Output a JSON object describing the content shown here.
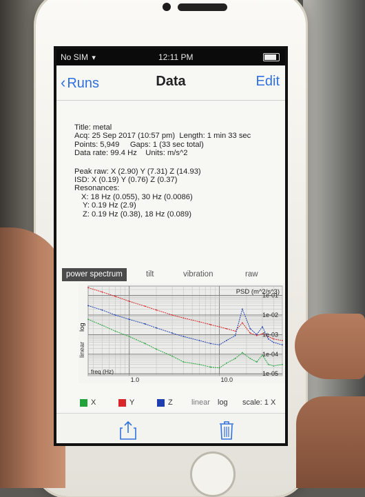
{
  "status": {
    "carrier": "No SIM",
    "time": "12:11 PM"
  },
  "nav": {
    "back_label": "Runs",
    "title": "Data",
    "edit_label": "Edit"
  },
  "info": {
    "title": "Title: metal",
    "acq": "Acq: 25 Sep 2017 (10:57 pm)",
    "length": "Length: 1 min 33 sec",
    "points": "Points: 5,949",
    "gaps": "Gaps: 1 (33 sec total)",
    "rate": "Data rate: 99.4 Hz",
    "units": "Units: m/s^2",
    "peak_raw": "Peak raw: X (2.90) Y (7.31) Z (14.93)",
    "isd": "ISD: X (0.19) Y (0.76) Z (0.37)",
    "resonances_label": "Resonances:",
    "res_x": "X:  18 Hz (0.055), 30 Hz (0.0086)",
    "res_y": "Y:  0.19 Hz (2.9)",
    "res_z": "Z:  0.19 Hz (0.38), 18 Hz (0.089)"
  },
  "tabs": [
    "power spectrum",
    "tilt",
    "vibration",
    "raw"
  ],
  "chart_labels": {
    "y_unit": "PSD (m^2/s^3)",
    "y_ticks": [
      "1e-01",
      "1e-02",
      "1e-03",
      "1e-04",
      "1e-05"
    ],
    "x_label": "freq (Hz)",
    "x_ticks": [
      "1.0",
      "10.0"
    ],
    "axis_linear": "linear",
    "axis_log": "log"
  },
  "chart_data": {
    "type": "line",
    "xlabel": "freq (Hz)",
    "ylabel": "PSD (m^2/s^3)",
    "x_scale": "log",
    "y_scale": "log",
    "xlim": [
      0.35,
      50
    ],
    "ylim": [
      8e-06,
      0.3
    ],
    "grid": true,
    "series": [
      {
        "name": "X",
        "color": "#21a33a",
        "x": [
          0.35,
          0.5,
          0.7,
          1.0,
          1.5,
          2.0,
          3.0,
          4.0,
          6.0,
          8.0,
          10.0,
          12.0,
          15.0,
          18.0,
          22.0,
          26.0,
          30.0,
          35.0,
          40.0,
          50.0
        ],
        "y": [
          0.006,
          0.003,
          0.0015,
          0.0008,
          0.00035,
          0.00018,
          8e-05,
          4e-05,
          3e-05,
          2.2e-05,
          2e-05,
          3.5e-05,
          6e-05,
          0.00012,
          6e-05,
          4e-05,
          9e-05,
          3e-05,
          2.5e-05,
          3e-05
        ]
      },
      {
        "name": "Y",
        "color": "#d9262a",
        "x": [
          0.35,
          0.5,
          0.7,
          1.0,
          1.5,
          2.0,
          3.0,
          4.0,
          6.0,
          8.0,
          10.0,
          12.0,
          15.0,
          18.0,
          22.0,
          26.0,
          30.0,
          35.0,
          40.0,
          50.0
        ],
        "y": [
          0.25,
          0.15,
          0.09,
          0.05,
          0.028,
          0.018,
          0.01,
          0.007,
          0.0045,
          0.0032,
          0.0025,
          0.002,
          0.0015,
          0.004,
          0.0012,
          0.0009,
          0.0011,
          0.0008,
          0.0006,
          0.0005
        ]
      },
      {
        "name": "Z",
        "color": "#1f3fb0",
        "x": [
          0.35,
          0.5,
          0.7,
          1.0,
          1.5,
          2.0,
          3.0,
          4.0,
          6.0,
          8.0,
          10.0,
          12.0,
          15.0,
          18.0,
          22.0,
          26.0,
          30.0,
          35.0,
          40.0,
          50.0
        ],
        "y": [
          0.03,
          0.018,
          0.01,
          0.006,
          0.0035,
          0.0022,
          0.0012,
          0.0008,
          0.0005,
          0.00035,
          0.0003,
          0.0005,
          0.0009,
          0.02,
          0.002,
          0.001,
          0.0025,
          0.0006,
          0.0004,
          0.0003
        ]
      }
    ]
  },
  "legend": {
    "items": [
      {
        "label": "X",
        "color": "#21a33a"
      },
      {
        "label": "Y",
        "color": "#d9262a"
      },
      {
        "label": "Z",
        "color": "#1f3fb0"
      }
    ],
    "linear": "linear",
    "log": "log",
    "scale": "scale: 1 X"
  },
  "toolbar": {
    "share_icon": "share-icon",
    "trash_icon": "trash-icon"
  },
  "colors": {
    "accent": "#2f6fe0",
    "tab_active_bg": "#4b4b4b"
  }
}
